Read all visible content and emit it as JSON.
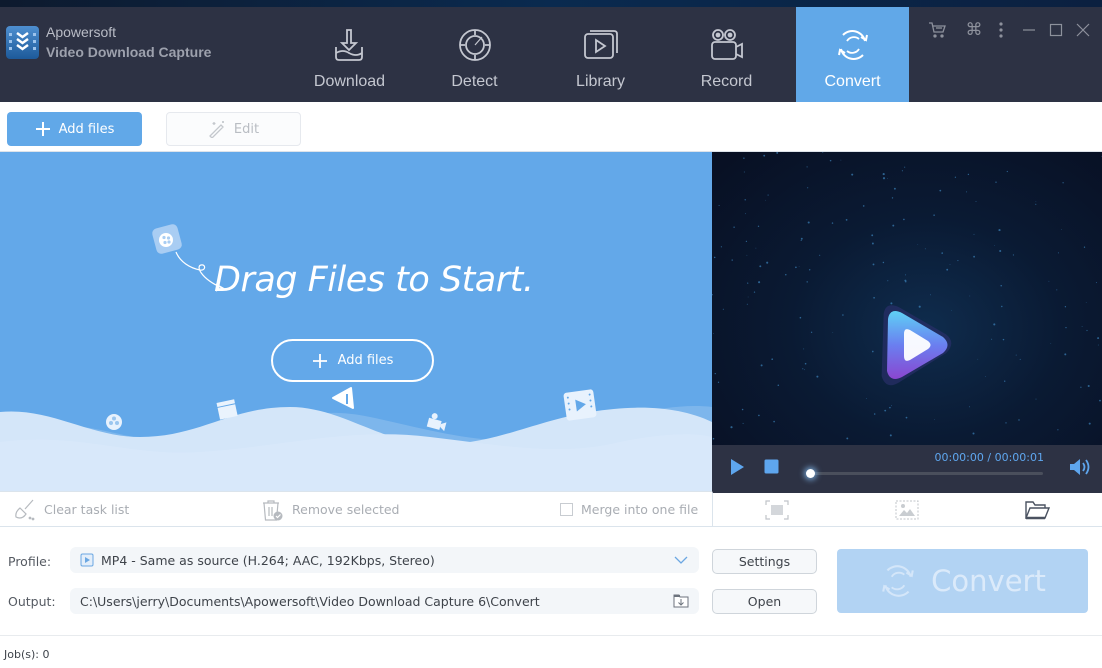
{
  "app": {
    "brand_line1": "Apowersoft",
    "brand_line2": "Video Download Capture"
  },
  "nav": {
    "items": [
      {
        "label": "Download",
        "icon": "download-icon",
        "active": false
      },
      {
        "label": "Detect",
        "icon": "detect-icon",
        "active": false
      },
      {
        "label": "Library",
        "icon": "library-icon",
        "active": false
      },
      {
        "label": "Record",
        "icon": "camera-icon",
        "active": false
      },
      {
        "label": "Convert",
        "icon": "convert-icon",
        "active": true
      }
    ]
  },
  "window_controls": [
    "cart-icon",
    "command-icon",
    "more-icon",
    "minimize-icon",
    "maximize-icon",
    "close-icon"
  ],
  "toolbar": {
    "add_files_label": "Add files",
    "edit_label": "Edit"
  },
  "dropzone": {
    "title": "Drag Files to Start.",
    "add_files_label": "Add files"
  },
  "player": {
    "time": "00:00:00 / 00:00:01",
    "progress": 0
  },
  "tasks": {
    "clear_label": "Clear task list",
    "remove_label": "Remove selected",
    "merge_label": "Merge into one file",
    "merge_checked": false
  },
  "settings": {
    "profile_label": "Profile:",
    "profile_value": "MP4 - Same as source (H.264; AAC, 192Kbps, Stereo)",
    "settings_button": "Settings",
    "output_label": "Output:",
    "output_value": "C:\\Users\\jerry\\Documents\\Apowersoft\\Video Download Capture 6\\Convert",
    "open_button": "Open",
    "convert_button": "Convert"
  },
  "status": {
    "jobs": "Job(s): 0"
  },
  "colors": {
    "accent": "#61a8e8",
    "titlebar": "#2d3244",
    "convert_disabled": "#b2d3f3"
  }
}
